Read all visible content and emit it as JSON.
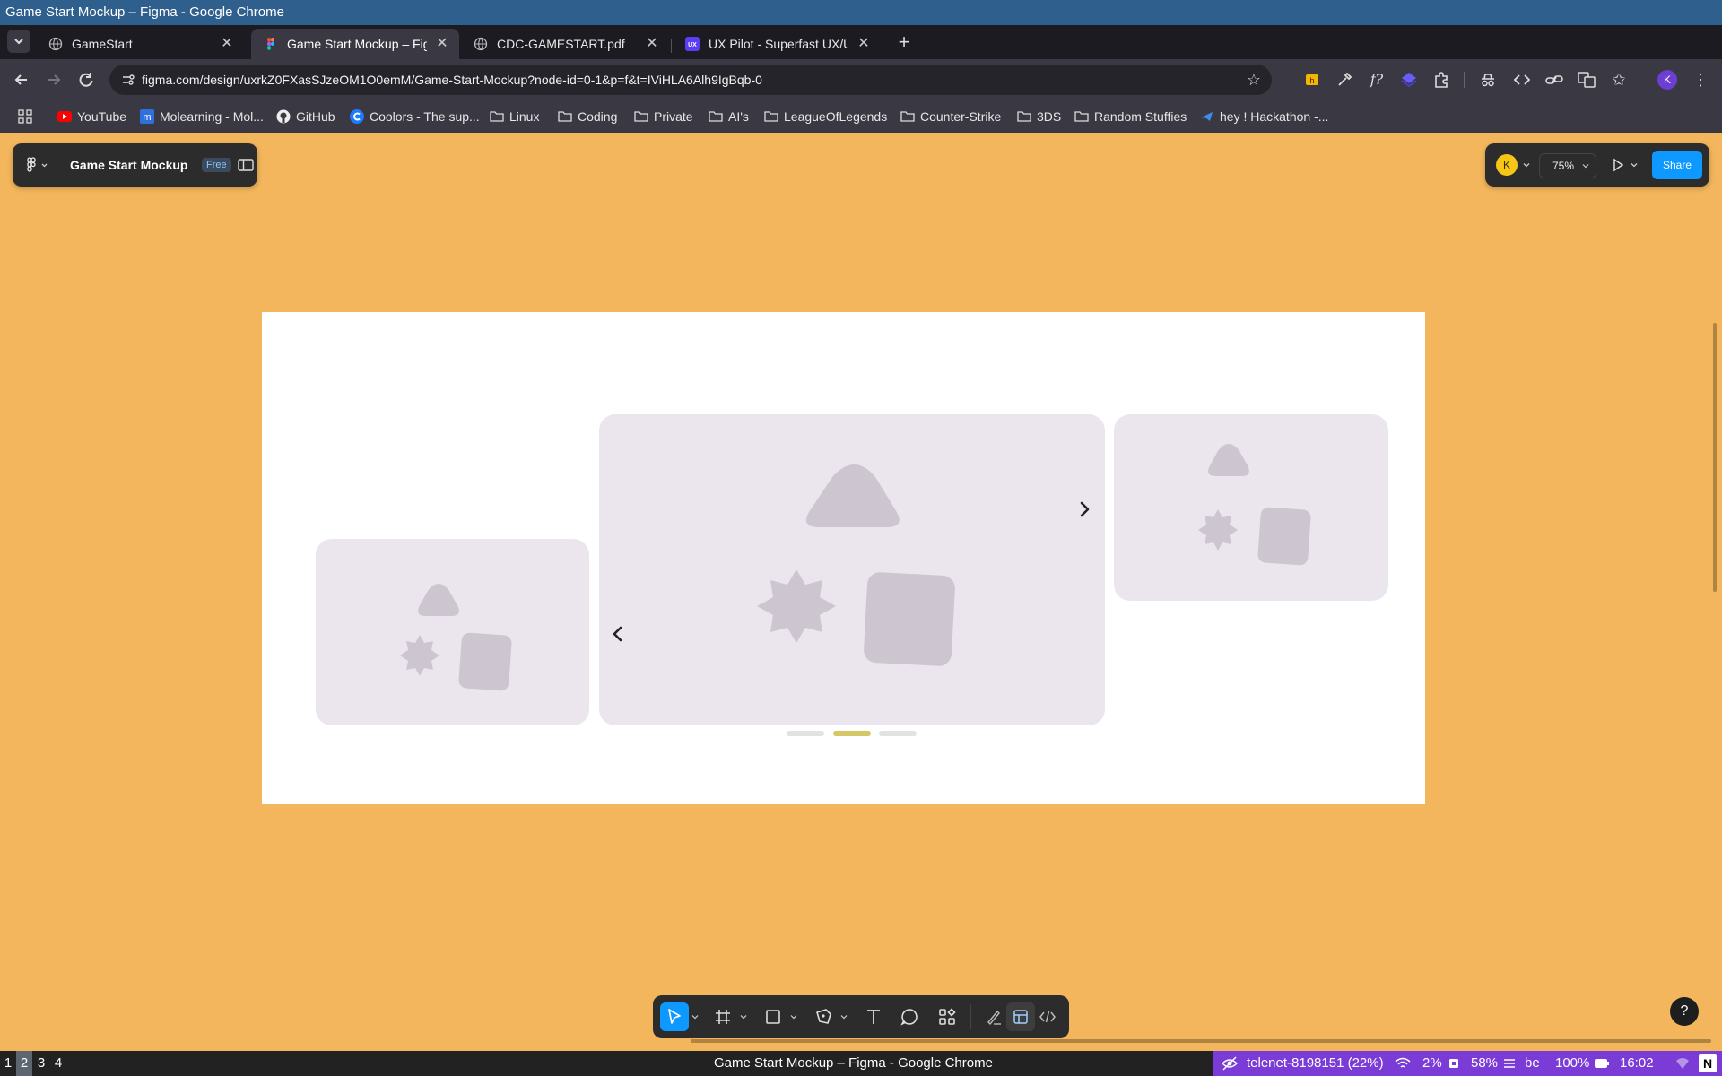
{
  "window": {
    "title": "Game Start Mockup – Figma - Google Chrome"
  },
  "tabs": [
    {
      "label": "GameStart",
      "icon": "globe-icon",
      "active": false
    },
    {
      "label": "Game Start Mockup – Figma",
      "icon": "figma-icon",
      "active": true
    },
    {
      "label": "CDC-GAMESTART.pdf",
      "icon": "globe-icon",
      "active": false
    },
    {
      "label": "UX Pilot - Superfast UX/UI Design",
      "icon": "ux-icon",
      "active": false
    }
  ],
  "address": {
    "url": "figma.com/design/uxrkZ0FXasSJzeOM1O0emM/Game-Start-Mockup?node-id=0-1&p=f&t=IViHLA6Alh9IgBqb-0"
  },
  "profile": {
    "initial": "K"
  },
  "bookmarks": [
    {
      "label": "YouTube",
      "icon": "youtube-icon"
    },
    {
      "label": "Molearning - Mol...",
      "icon": "molearning-icon"
    },
    {
      "label": "GitHub",
      "icon": "github-icon"
    },
    {
      "label": "Coolors - The sup...",
      "icon": "coolors-icon"
    },
    {
      "label": "Linux",
      "icon": "folder-icon"
    },
    {
      "label": "Coding",
      "icon": "folder-icon"
    },
    {
      "label": "Private",
      "icon": "folder-icon"
    },
    {
      "label": "AI's",
      "icon": "folder-icon"
    },
    {
      "label": "LeagueOfLegends",
      "icon": "folder-icon"
    },
    {
      "label": "Counter-Strike",
      "icon": "folder-icon"
    },
    {
      "label": "3DS",
      "icon": "folder-icon"
    },
    {
      "label": "Random Stuffies",
      "icon": "folder-icon"
    },
    {
      "label": "hey ! Hackathon -...",
      "icon": "hackathon-icon"
    }
  ],
  "figma": {
    "file_name": "Game Start Mockup",
    "plan_badge": "Free",
    "user_initial": "K",
    "zoom": "75%",
    "share_label": "Share",
    "carousel": {
      "slide_count": 3,
      "active_index": 1
    },
    "colors": {
      "canvas": "#f3b65c",
      "card": "#ebe6ee",
      "shape": "#cdc6d0",
      "active_dot": "#d6c766",
      "dot": "#e2e2e2",
      "share": "#0d99ff"
    },
    "help_label": "?"
  },
  "statusbar": {
    "workspaces": [
      "1",
      "2",
      "3",
      "4"
    ],
    "active_workspace": "2",
    "window_title": "Game Start Mockup – Figma - Google Chrome",
    "network": "telenet-8198151 (22%)",
    "cpu": "2%",
    "memory": "58%",
    "keyboard": "be",
    "battery": "100%",
    "clock": "16:02"
  }
}
